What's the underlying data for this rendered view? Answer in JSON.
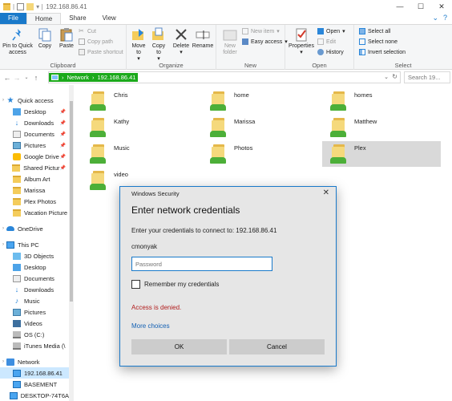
{
  "window": {
    "title": "192.168.86.41",
    "controls": {
      "minimize": "—",
      "maximize": "☐",
      "close": "✕"
    }
  },
  "ribbon_tabs": [
    "File",
    "Home",
    "Share",
    "View"
  ],
  "ribbon": {
    "clipboard": {
      "label": "Clipboard",
      "pin_quick_access": "Pin to Quick access",
      "copy": "Copy",
      "paste": "Paste",
      "cut": "Cut",
      "copy_path": "Copy path",
      "paste_shortcut": "Paste shortcut"
    },
    "organize": {
      "label": "Organize",
      "move_to": "Move to",
      "copy_to": "Copy to",
      "delete": "Delete",
      "rename": "Rename"
    },
    "new": {
      "label": "New",
      "new_folder": "New folder",
      "new_item": "New item",
      "easy_access": "Easy access"
    },
    "open": {
      "label": "Open",
      "properties": "Properties",
      "open": "Open",
      "edit": "Edit",
      "history": "History"
    },
    "select": {
      "label": "Select",
      "select_all": "Select all",
      "select_none": "Select none",
      "invert_selection": "Invert selection"
    }
  },
  "address": {
    "crumbs": [
      "Network",
      "192.168.86.41"
    ],
    "search_placeholder": "Search 19..."
  },
  "nav": {
    "items": [
      {
        "label": "Quick access",
        "icon": "star-icon",
        "pinned": false
      },
      {
        "label": "Desktop",
        "icon": "desktop-icon",
        "pinned": true
      },
      {
        "label": "Downloads",
        "icon": "download-icon",
        "pinned": true
      },
      {
        "label": "Documents",
        "icon": "documents-icon",
        "pinned": true
      },
      {
        "label": "Pictures",
        "icon": "pictures-icon",
        "pinned": true
      },
      {
        "label": "Google Drive",
        "icon": "google-drive-icon",
        "pinned": true
      },
      {
        "label": "Shared Pictur",
        "icon": "folder-icon",
        "pinned": true
      },
      {
        "label": "Album Art",
        "icon": "folder-icon",
        "pinned": false
      },
      {
        "label": "Marissa",
        "icon": "folder-icon",
        "pinned": false
      },
      {
        "label": "Plex Photos",
        "icon": "folder-icon",
        "pinned": false
      },
      {
        "label": "Vacation Picture",
        "icon": "folder-icon",
        "pinned": false
      },
      {
        "label": "OneDrive",
        "icon": "onedrive-icon",
        "pinned": false
      },
      {
        "label": "This PC",
        "icon": "pc-icon",
        "pinned": false
      },
      {
        "label": "3D Objects",
        "icon": "3d-objects-icon",
        "pinned": false
      },
      {
        "label": "Desktop",
        "icon": "desktop-icon",
        "pinned": false
      },
      {
        "label": "Documents",
        "icon": "documents-icon",
        "pinned": false
      },
      {
        "label": "Downloads",
        "icon": "download-icon",
        "pinned": false
      },
      {
        "label": "Music",
        "icon": "music-icon",
        "pinned": false
      },
      {
        "label": "Pictures",
        "icon": "pictures-icon",
        "pinned": false
      },
      {
        "label": "Videos",
        "icon": "videos-icon",
        "pinned": false
      },
      {
        "label": "OS (C:)",
        "icon": "drive-icon",
        "pinned": false
      },
      {
        "label": "iTunes Media (\\",
        "icon": "network-drive-icon",
        "pinned": false
      },
      {
        "label": "Network",
        "icon": "network-icon",
        "pinned": false
      },
      {
        "label": "192.168.86.41",
        "icon": "pc-icon",
        "pinned": false
      },
      {
        "label": "BASEMENT",
        "icon": "pc-icon",
        "pinned": false
      },
      {
        "label": "DESKTOP-74T6A",
        "icon": "pc-icon",
        "pinned": false
      }
    ]
  },
  "files": [
    {
      "name": "Chris"
    },
    {
      "name": "home"
    },
    {
      "name": "homes"
    },
    {
      "name": "Kathy"
    },
    {
      "name": "Marissa"
    },
    {
      "name": "Matthew"
    },
    {
      "name": "Music"
    },
    {
      "name": "Photos"
    },
    {
      "name": "Plex"
    },
    {
      "name": "video"
    }
  ],
  "dialog": {
    "window_title": "Windows Security",
    "heading": "Enter network credentials",
    "subtitle": "Enter your credentials to connect to: 192.168.86.41",
    "username": "cmonyak",
    "password_placeholder": "Password",
    "remember_label": "Remember my credentials",
    "error": "Access is denied.",
    "more_choices": "More choices",
    "ok": "OK",
    "cancel": "Cancel"
  },
  "colors": {
    "accent": "#1979ca",
    "address_highlight": "#1ba91b",
    "error": "#b11d1d",
    "link": "#1360b3"
  }
}
